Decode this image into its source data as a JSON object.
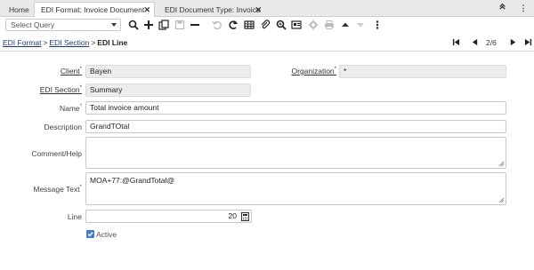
{
  "tabs": [
    {
      "label": "Home"
    },
    {
      "label": "EDI Format: Invoice Document",
      "close": "✕"
    },
    {
      "label": "EDI Document Type: Invoice",
      "close": "✕"
    }
  ],
  "window_controls": {
    "collapse": "⌃",
    "menu": "⋮"
  },
  "toolbar": {
    "query_placeholder": "Select Query",
    "icons": [
      "search-icon",
      "new-record-icon",
      "copy-record-icon",
      "save-icon",
      "delete-icon",
      "undo-icon",
      "refresh-icon",
      "grid-toggle-icon",
      "attachment-icon",
      "zoom-across-icon",
      "report-icon",
      "process-icon",
      "print-icon",
      "previous-record-icon",
      "next-record-icon",
      "more-icon"
    ]
  },
  "breadcrumb": {
    "items": [
      "EDI Format",
      "EDI Section"
    ],
    "separator": ">",
    "current": "EDI Line"
  },
  "navigation": {
    "record_count": "2/6"
  },
  "form": {
    "client": {
      "label": "Client",
      "required": "*",
      "value": "Bayen"
    },
    "organization": {
      "label": "Organization",
      "required": "*",
      "value": "*"
    },
    "edi_section": {
      "label": "EDI Section",
      "required": "*",
      "value": "Summary"
    },
    "name": {
      "label": "Name",
      "required": "*",
      "value": "Total invoice amount"
    },
    "description": {
      "label": "Description",
      "value": "GrandTOtal"
    },
    "comment_help": {
      "label": "Comment/Help",
      "value": ""
    },
    "message_text": {
      "label": "Message Text",
      "required": "*",
      "value": "MOA+77:@GrandTotal@"
    },
    "line": {
      "label": "Line",
      "value": "20"
    },
    "active": {
      "label": "Active",
      "checked": true
    }
  },
  "colors": {
    "accent": "#3f7fc4",
    "link": "#1a3a7a",
    "readonly_bg": "#ececec"
  }
}
